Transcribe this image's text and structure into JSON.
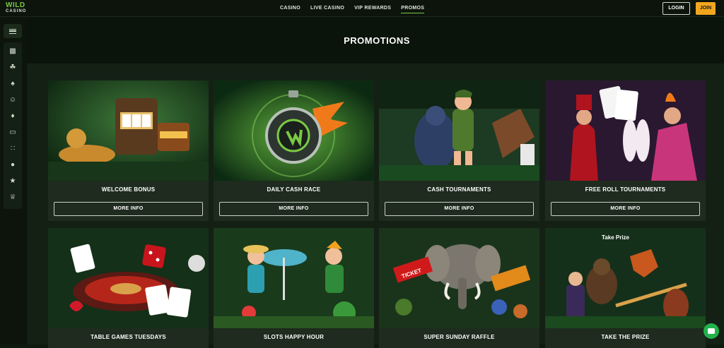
{
  "brand": {
    "logo_top": "WILD",
    "logo_bottom": "CASINO"
  },
  "nav": {
    "items": [
      {
        "label": "CASINO",
        "active": false
      },
      {
        "label": "LIVE CASINO",
        "active": false
      },
      {
        "label": "VIP REWARDS",
        "active": false
      },
      {
        "label": "PROMOS",
        "active": true
      }
    ]
  },
  "auth": {
    "login_label": "LOGIN",
    "join_label": "JOIN"
  },
  "sidebar": {
    "menu_icon": "hamburger-icon",
    "icons": [
      "slots-icon",
      "cherries-icon",
      "spade-icon",
      "live-dealer-icon",
      "cards-icon",
      "laptop-icon",
      "dice-icon",
      "basketball-icon",
      "trophy-icon",
      "crown-icon"
    ]
  },
  "page": {
    "title": "PROMOTIONS"
  },
  "promos": {
    "more_label": "MORE INFO",
    "cards": [
      {
        "title": "WELCOME BONUS"
      },
      {
        "title": "DAILY CASH RACE"
      },
      {
        "title": "CASH TOURNAMENTS"
      },
      {
        "title": "FREE ROLL TOURNAMENTS"
      },
      {
        "title": "TABLE GAMES TUESDAYS"
      },
      {
        "title": "SLOTS HAPPY HOUR"
      },
      {
        "title": "SUPER SUNDAY RAFFLE"
      },
      {
        "title": "TAKE THE PRIZE"
      }
    ],
    "art_text": {
      "ticket": "TICKET",
      "take_prize": "Take Prize"
    }
  },
  "colors": {
    "accent": "#7ac943",
    "join": "#f2a61e",
    "background": "#0f1a0f",
    "chat": "#22b14c"
  }
}
